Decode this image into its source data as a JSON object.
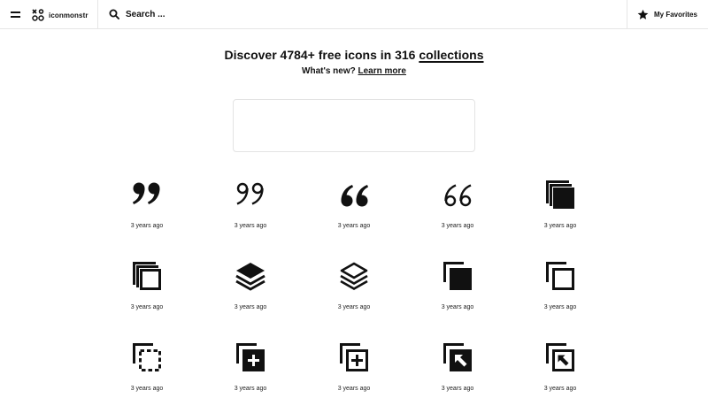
{
  "header": {
    "menu_icon": "hamburger-icon",
    "logo_icon": "iconmonstr-logo-icon",
    "logo_text": "iconmonstr",
    "search_icon": "search-icon",
    "search_placeholder": "Search ...",
    "favorites_icon": "star-icon",
    "favorites_label": "My Favorites"
  },
  "hero": {
    "title_prefix": "Discover 4784+ free icons in 316 ",
    "title_link": "collections",
    "sub_prefix": "What's new? ",
    "sub_link": "Learn more"
  },
  "icons": [
    {
      "name": "quote-right-filled-icon",
      "time": "3 years ago"
    },
    {
      "name": "quote-right-outline-icon",
      "time": "3 years ago"
    },
    {
      "name": "quote-left-filled-icon",
      "time": "3 years ago"
    },
    {
      "name": "quote-left-outline-icon",
      "time": "3 years ago"
    },
    {
      "name": "copy-filled-icon",
      "time": "3 years ago"
    },
    {
      "name": "copy-outline-icon",
      "time": "3 years ago"
    },
    {
      "name": "layers-filled-icon",
      "time": "3 years ago"
    },
    {
      "name": "layers-outline-icon",
      "time": "3 years ago"
    },
    {
      "name": "duplicate-filled-icon",
      "time": "3 years ago"
    },
    {
      "name": "duplicate-outline-icon",
      "time": "3 years ago"
    },
    {
      "name": "duplicate-dashed-icon",
      "time": "3 years ago"
    },
    {
      "name": "duplicate-add-filled-icon",
      "time": "3 years ago"
    },
    {
      "name": "duplicate-add-outline-icon",
      "time": "3 years ago"
    },
    {
      "name": "duplicate-arrow-filled-icon",
      "time": "3 years ago"
    },
    {
      "name": "duplicate-arrow-outline-icon",
      "time": "3 years ago"
    }
  ]
}
